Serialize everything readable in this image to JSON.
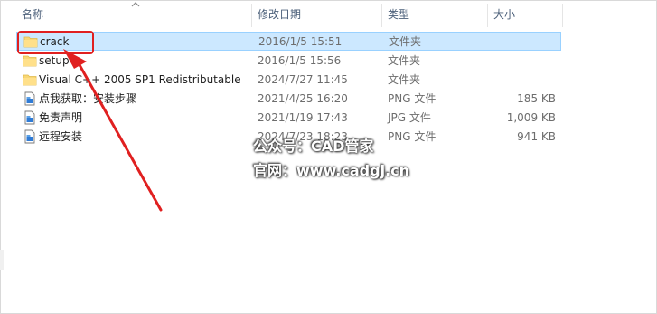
{
  "columns": {
    "name": "名称",
    "modified": "修改日期",
    "type": "类型",
    "size": "大小"
  },
  "files": [
    {
      "name": "crack",
      "modified": "2016/1/5 15:51",
      "type": "文件夹",
      "size": "",
      "icon": "folder-icon",
      "selected": true
    },
    {
      "name": "setup",
      "modified": "2016/1/5 15:56",
      "type": "文件夹",
      "size": "",
      "icon": "folder-icon"
    },
    {
      "name": "Visual C++ 2005 SP1 Redistributable",
      "modified": "2024/7/27 11:45",
      "type": "文件夹",
      "size": "",
      "icon": "folder-icon"
    },
    {
      "name": "点我获取：安装步骤",
      "modified": "2021/4/25 16:20",
      "type": "PNG 文件",
      "size": "185 KB",
      "icon": "image-file-icon"
    },
    {
      "name": "免责声明",
      "modified": "2021/1/19 17:43",
      "type": "JPG 文件",
      "size": "1,009 KB",
      "icon": "image-file-icon"
    },
    {
      "name": "远程安装",
      "modified": "2024/7/23 18:23",
      "type": "PNG 文件",
      "size": "941 KB",
      "icon": "image-file-icon"
    }
  ],
  "watermark": {
    "line1": "公众号：CAD管家",
    "line2": "官网：www.cadgj.cn"
  },
  "colors": {
    "selection_bg": "#cce8ff",
    "selection_border": "#99d1ff",
    "folder": "#f8d775",
    "annotation_red": "#e02020"
  }
}
